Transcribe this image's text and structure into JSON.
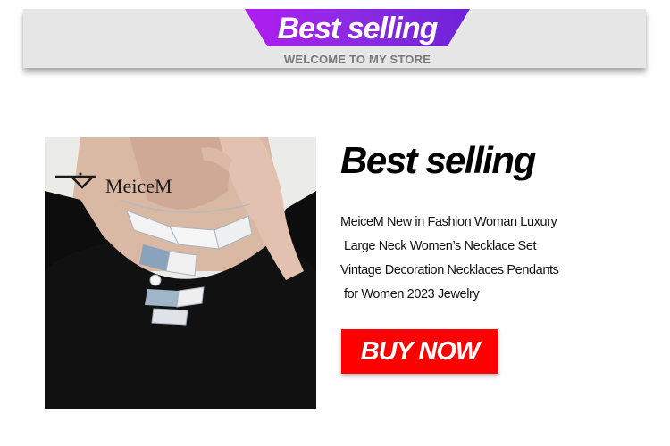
{
  "header": {
    "title": "Best selling",
    "subtitle": "WELCOME TO MY STORE",
    "ribbon_color": "#9b27e6"
  },
  "product": {
    "brand": "MeiceM",
    "photo_subject": "woman wearing silver geometric statement necklace"
  },
  "section": {
    "title": "Best selling",
    "description_lines": [
      "MeiceM New in Fashion Woman Luxury",
      "Large Neck Women’s Necklace Set",
      "Vintage Decoration Necklaces Pendants",
      "for Women 2023 Jewelry"
    ],
    "buy_label": "BUY NOW",
    "buy_color": "#ff0000"
  }
}
